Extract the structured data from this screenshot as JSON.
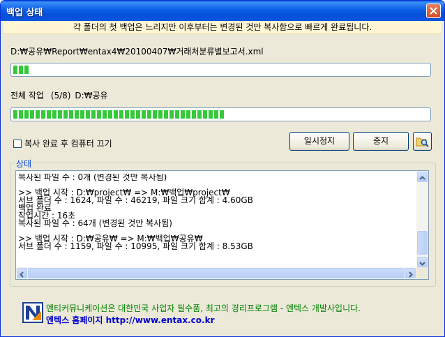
{
  "window": {
    "title": "백업 상태",
    "close_icon": "close-icon"
  },
  "banner": {
    "text": "각 폴더의 첫 백업은 느리지만 이후부터는 변경된 것만 복사함으로 빠르게 완료됩니다."
  },
  "current_file": {
    "path": "D:₩공유₩Report₩entax4₩20100407₩거래처분류별보고서.xml",
    "progress": 0.04
  },
  "overall": {
    "label": "전체 작업",
    "count": "(5/8)",
    "folder": "D:₩공유",
    "progress": 0.51
  },
  "options": {
    "shutdown_label": "복사 완료 후 컴퓨터 끄기",
    "shutdown_checked": false
  },
  "buttons": {
    "pause": "일시정지",
    "stop": "중지",
    "folder_icon": "folder-search-icon"
  },
  "status": {
    "group_label": "상태",
    "log_lines": [
      "복사된 파일 수 : 0개 (변경된 것만 복사됨)",
      "",
      ">> 백업 시작 : D:₩project₩ => M:₩백업₩project₩",
      "서브 폴더 수 : 1624, 파일 수 : 46219, 파일 크기 합계 : 4.60GB",
      "백업 완료",
      "작업시간 : 16초",
      "복사된 파일 수 : 64개 (변경된 것만 복사됨)",
      "",
      ">> 백업 시작 : D:₩공유₩ => M:₩백업₩공유₩",
      "서브 폴더 수 : 1159, 파일 수 : 10995, 파일 크기 합계 : 8.53GB"
    ]
  },
  "footer": {
    "company_line": "엔티커뮤니케이션은 대한민국 사업자 필수품, 최고의 경리프로그램 - 엔텍스 개발사입니다.",
    "homepage_line": "엔텍스 홈페이지 http://www.entax.co.kr",
    "logo_icon": "entax-logo-icon"
  },
  "colors": {
    "titlebar": "#0a55e0",
    "progress_fill": "#35c93a",
    "banner_bg": "#fff6d6",
    "footer_green": "#008000",
    "footer_blue": "#0000cc"
  }
}
